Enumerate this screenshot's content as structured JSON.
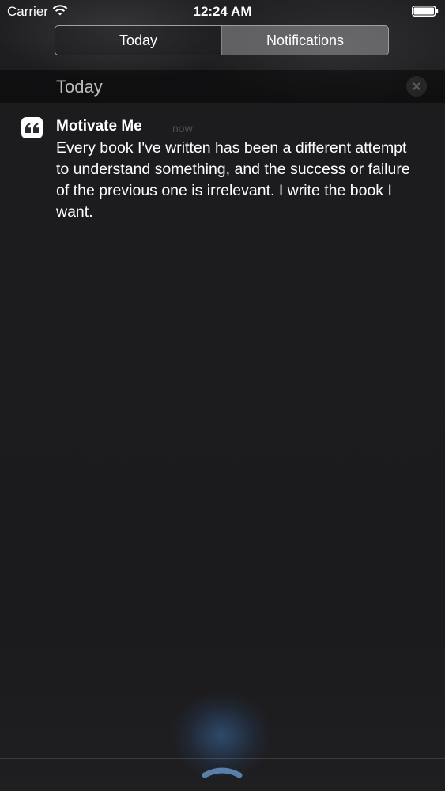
{
  "status_bar": {
    "carrier": "Carrier",
    "time": "12:24 AM",
    "wifi_icon": "wifi-icon",
    "battery_icon": "battery-icon"
  },
  "segmented_control": {
    "tabs": [
      {
        "label": "Today",
        "selected": false
      },
      {
        "label": "Notifications",
        "selected": true
      }
    ]
  },
  "section": {
    "title": "Today",
    "clear_icon": "close-icon"
  },
  "notification": {
    "app_icon": "quote-icon",
    "app_name": "Motivate Me",
    "timestamp": "now",
    "message": "Every book I've written has been a different attempt to understand something, and the success or failure of the previous one is irrelevant. I write the book I want."
  },
  "bottom": {
    "grabber_icon": "chevron-up-icon"
  },
  "colors": {
    "background": "#1b1b1d",
    "text": "#ffffff",
    "glow": "#3c6eaa"
  }
}
